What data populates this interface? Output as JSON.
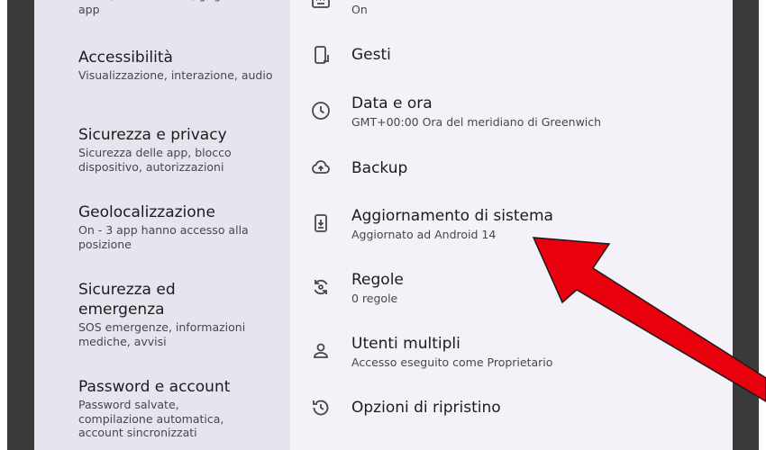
{
  "left_menu": [
    {
      "title": "",
      "subtitle": "Colori, icone a tema, griglia delle app"
    },
    {
      "title": "Accessibilità",
      "subtitle": "Visualizzazione, interazione, audio"
    },
    {
      "title": "Sicurezza e privacy",
      "subtitle": "Sicurezza delle app, blocco dispositivo, autorizzazioni"
    },
    {
      "title": "Geolocalizzazione",
      "subtitle": "On - 3 app hanno accesso alla posizione"
    },
    {
      "title": "Sicurezza ed emergenza",
      "subtitle": "SOS emergenze, informazioni mediche, avvisi"
    },
    {
      "title": "Password e account",
      "subtitle": "Password salvate, compilazione automatica, account sincronizzati"
    }
  ],
  "system_items": [
    {
      "icon": "keyboard-icon",
      "title": "",
      "subtitle": "On"
    },
    {
      "icon": "gestures-icon",
      "title": "Gesti",
      "subtitle": ""
    },
    {
      "icon": "clock-icon",
      "title": "Data e ora",
      "subtitle": "GMT+00:00 Ora del meridiano di Greenwich"
    },
    {
      "icon": "cloud-upload-icon",
      "title": "Backup",
      "subtitle": ""
    },
    {
      "icon": "system-update-icon",
      "title": "Aggiornamento di sistema",
      "subtitle": "Aggiornato ad Android 14"
    },
    {
      "icon": "rules-icon",
      "title": "Regole",
      "subtitle": "0 regole"
    },
    {
      "icon": "person-icon",
      "title": "Utenti multipli",
      "subtitle": "Accesso eseguito come Proprietario"
    },
    {
      "icon": "restore-icon",
      "title": "Opzioni di ripristino",
      "subtitle": ""
    }
  ],
  "colors": {
    "left_panel": "#e6e4ec",
    "right_panel": "#f4f2f8",
    "annotation_arrow": "#e8000d"
  }
}
